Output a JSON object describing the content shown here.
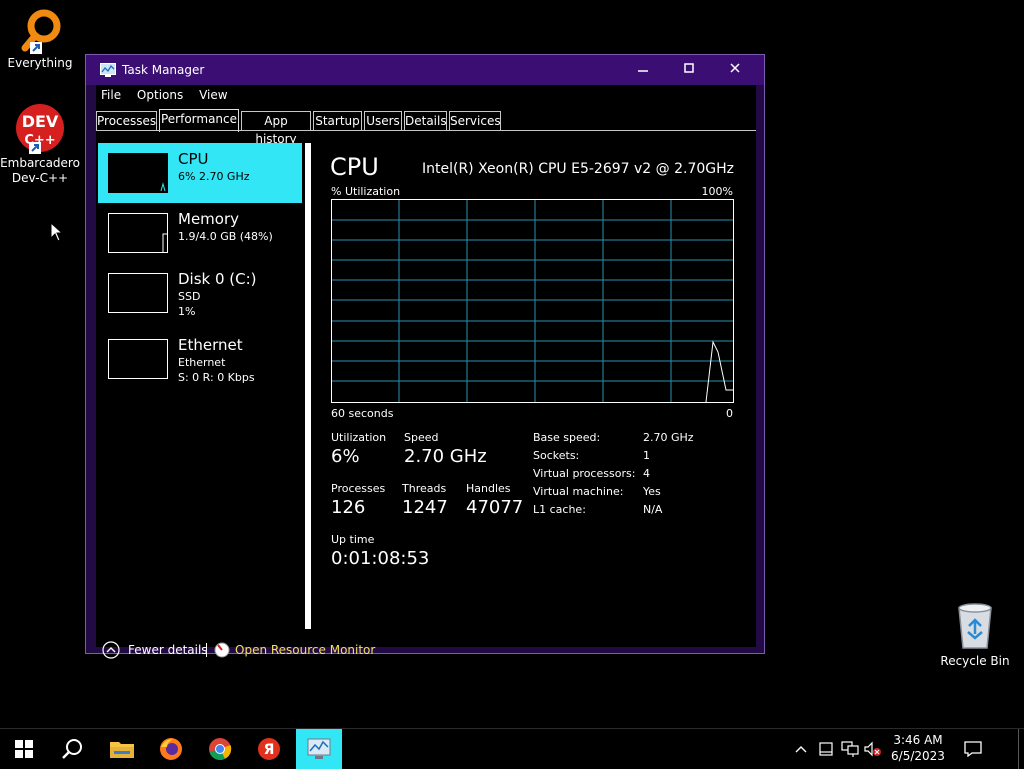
{
  "desktop": {
    "icons": [
      {
        "name": "Everything"
      },
      {
        "name": "Embarcadero Dev-C++",
        "line1": "Embarcadero",
        "line2": "Dev-C++"
      },
      {
        "name": "Recycle Bin"
      }
    ]
  },
  "window": {
    "title": "Task Manager",
    "menu": [
      "File",
      "Options",
      "View"
    ],
    "tabs": [
      "Processes",
      "Performance",
      "App history",
      "Startup",
      "Users",
      "Details",
      "Services"
    ],
    "active_tab": "Performance"
  },
  "sidebar": {
    "items": [
      {
        "name": "CPU",
        "detail1": "6% 2.70 GHz",
        "detail2": ""
      },
      {
        "name": "Memory",
        "detail1": "1.9/4.0 GB (48%)",
        "detail2": ""
      },
      {
        "name": "Disk 0 (C:)",
        "detail1": "SSD",
        "detail2": "1%"
      },
      {
        "name": "Ethernet",
        "detail1": "Ethernet",
        "detail2": "S: 0 R: 0 Kbps"
      }
    ]
  },
  "main": {
    "title": "CPU",
    "cpu_model": "Intel(R) Xeon(R) CPU E5-2697 v2 @ 2.70GHz",
    "graph_label": "% Utilization",
    "graph_max": "100%",
    "axis_left": "60 seconds",
    "axis_right": "0",
    "utilization_label": "Utilization",
    "utilization": "6%",
    "speed_label": "Speed",
    "speed": "2.70 GHz",
    "processes_label": "Processes",
    "processes": "126",
    "threads_label": "Threads",
    "threads": "1247",
    "handles_label": "Handles",
    "handles": "47077",
    "uptime_label": "Up time",
    "uptime": "0:01:08:53",
    "specs": [
      {
        "k": "Base speed:",
        "v": "2.70 GHz"
      },
      {
        "k": "Sockets:",
        "v": "1"
      },
      {
        "k": "Virtual processors:",
        "v": "4"
      },
      {
        "k": "Virtual machine:",
        "v": "Yes"
      },
      {
        "k": "L1 cache:",
        "v": "N/A"
      }
    ]
  },
  "footer": {
    "fewer_details": "Fewer details",
    "resource_monitor": "Open Resource Monitor"
  },
  "taskbar": {
    "time": "3:46 AM",
    "date": "6/5/2023"
  },
  "colors": {
    "accent": "#33e6f5",
    "title_bar": "#3a0e72",
    "graph_grid": "#2a8fb0",
    "link": "#f0e060"
  }
}
